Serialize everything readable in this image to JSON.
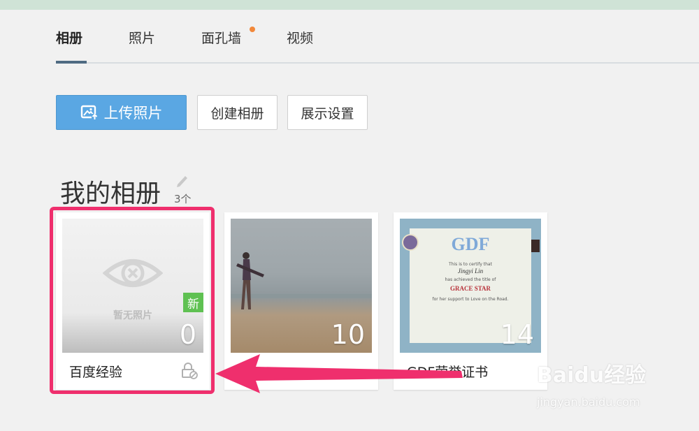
{
  "tabs": [
    {
      "label": "相册",
      "active": true
    },
    {
      "label": "照片",
      "active": false
    },
    {
      "label": "面孔墙",
      "active": false,
      "has_dot": true
    },
    {
      "label": "视频",
      "active": false
    }
  ],
  "toolbar": {
    "upload_label": "上传照片",
    "create_label": "创建相册",
    "display_label": "展示设置"
  },
  "section": {
    "title": "我的相册",
    "count": "3个"
  },
  "albums": [
    {
      "name": "百度经验",
      "count": "0",
      "empty_text": "暂无照片",
      "badge": "新",
      "private": true
    },
    {
      "name": "",
      "count": "10"
    },
    {
      "name": "GDF荣誉证书",
      "count": "14",
      "cert": {
        "logo": "GDF",
        "line1": "This is to certify that",
        "signature": "Jingyi Lin",
        "line2": "has achieved the title of",
        "award": "GRACE STAR",
        "line3": "for her support to Love on the Road."
      }
    }
  ],
  "watermark": {
    "brand": "Baidu经验",
    "url": "jingyan.baidu.com"
  },
  "colors": {
    "accent": "#5aa7e3",
    "highlight": "#ef2f6d",
    "new_badge": "#5fc152",
    "tab_dot": "#f2883a"
  }
}
